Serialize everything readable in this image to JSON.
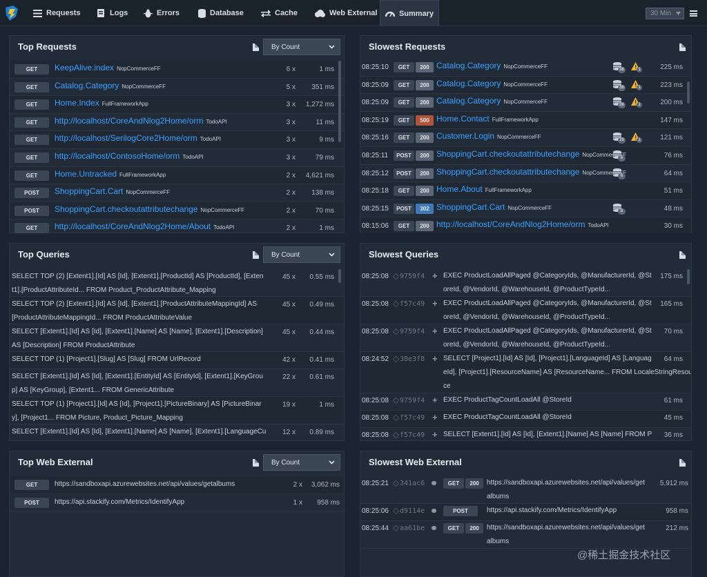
{
  "nav": {
    "tabs": [
      {
        "label": "Requests"
      },
      {
        "label": "Logs"
      },
      {
        "label": "Errors"
      },
      {
        "label": "Database"
      },
      {
        "label": "Cache"
      },
      {
        "label": "Web External"
      },
      {
        "label": "Summary"
      }
    ],
    "active_tab": "Summary",
    "time_range": "30 Min"
  },
  "top_requests": {
    "title": "Top Requests",
    "sort": "By Count",
    "rows": [
      {
        "verb": "GET",
        "name": "KeepAlive.index",
        "app": "NopCommerceFF",
        "count": "6 x",
        "ms": "1 ms"
      },
      {
        "verb": "GET",
        "name": "Catalog.Category",
        "app": "NopCommerceFF",
        "count": "5 x",
        "ms": "351 ms"
      },
      {
        "verb": "GET",
        "name": "Home.Index",
        "app": "FullFrameworkApp",
        "count": "3 x",
        "ms": "1,272 ms"
      },
      {
        "verb": "GET",
        "name": "http://localhost/CoreAndNlog2Home/orm",
        "app": "TodoAPI",
        "count": "3 x",
        "ms": "11 ms"
      },
      {
        "verb": "GET",
        "name": "http://localhost/SerilogCore2Home/orm",
        "app": "TodoAPI",
        "count": "3 x",
        "ms": "9 ms"
      },
      {
        "verb": "GET",
        "name": "http://localhost/ContosoHome/orm",
        "app": "TodoAPI",
        "count": "3 x",
        "ms": "79 ms"
      },
      {
        "verb": "GET",
        "name": "Home.Untracked",
        "app": "FullFrameworkApp",
        "count": "2 x",
        "ms": "4,621 ms"
      },
      {
        "verb": "POST",
        "name": "ShoppingCart.Cart",
        "app": "NopCommerceFF",
        "count": "2 x",
        "ms": "138 ms"
      },
      {
        "verb": "POST",
        "name": "ShoppingCart.checkoutattributechange",
        "app": "NopCommerceFF",
        "count": "2 x",
        "ms": "70 ms"
      },
      {
        "verb": "GET",
        "name": "http://localhost/CoreAndNlog2Home/About",
        "app": "TodoAPI",
        "count": "2 x",
        "ms": "1 ms"
      }
    ]
  },
  "slowest_requests": {
    "title": "Slowest Requests",
    "rows": [
      {
        "time": "08:25:10",
        "verb": "GET",
        "status": "200",
        "name": "Catalog.Category",
        "app": "NopCommerceFF",
        "db": "38",
        "warn": "1",
        "ms": "225 ms"
      },
      {
        "time": "08:25:09",
        "verb": "GET",
        "status": "200",
        "name": "Catalog.Category",
        "app": "NopCommerceFF",
        "db": "38",
        "warn": "1",
        "ms": "223 ms"
      },
      {
        "time": "08:25:09",
        "verb": "GET",
        "status": "200",
        "name": "Catalog.Category",
        "app": "NopCommerceFF",
        "db": "38",
        "warn": "1",
        "ms": "200 ms"
      },
      {
        "time": "08:25:19",
        "verb": "GET",
        "status": "500",
        "name": "Home.Contact",
        "app": "FullFrameworkApp",
        "db": "",
        "warn": "",
        "ms": "147 ms"
      },
      {
        "time": "08:25:16",
        "verb": "GET",
        "status": "200",
        "name": "Customer.Login",
        "app": "NopCommerceFF",
        "db": "29",
        "warn": "1",
        "ms": "121 ms"
      },
      {
        "time": "08:25:11",
        "verb": "POST",
        "status": "200",
        "name": "ShoppingCart.checkoutattributechange",
        "app": "NopCommerceFF",
        "db": "6",
        "warn": "",
        "ms": "76 ms"
      },
      {
        "time": "08:25:12",
        "verb": "POST",
        "status": "200",
        "name": "ShoppingCart.checkoutattributechange",
        "app": "NopCommerceFF",
        "db": "6",
        "warn": "",
        "ms": "64 ms"
      },
      {
        "time": "08:25:18",
        "verb": "GET",
        "status": "200",
        "name": "Home.About",
        "app": "FullFrameworkApp",
        "db": "",
        "warn": "",
        "ms": "51 ms"
      },
      {
        "time": "08:25:15",
        "verb": "POST",
        "status": "302",
        "name": "ShoppingCart.Cart",
        "app": "NopCommerceFF",
        "db": "8",
        "warn": "",
        "ms": "48 ms"
      },
      {
        "time": "08:15:06",
        "verb": "GET",
        "status": "200",
        "name": "http://localhost/CoreAndNlog2Home/orm",
        "app": "TodoAPI",
        "db": "",
        "warn": "",
        "ms": "30 ms"
      }
    ]
  },
  "top_queries": {
    "title": "Top Queries",
    "sort": "By Count",
    "rows": [
      {
        "l1": "SELECT TOP (2) [Extent1].[Id] AS [Id], [Extent1].[ProductId] AS [ProductId], [Exten",
        "l2": "t1].[ProductAttributeId... FROM Product_ProductAttribute_Mapping",
        "count": "45 x",
        "ms": "0.55 ms"
      },
      {
        "l1": "SELECT TOP (2) [Extent1].[Id] AS [Id], [Extent1].[ProductAttributeMappingId] AS",
        "l2": "[ProductAttributeMappingId... FROM ProductAttributeValue",
        "count": "45 x",
        "ms": "0.49 ms"
      },
      {
        "l1": "SELECT [Extent1].[Id] AS [Id], [Extent1].[Name] AS [Name], [Extent1].[Description]",
        "l2": "AS [Description] FROM ProductAttribute",
        "count": "45 x",
        "ms": "0.44 ms"
      },
      {
        "l1": "SELECT TOP (1) [Project1].[Slug] AS [Slug] FROM UrlRecord",
        "l2": "",
        "count": "42 x",
        "ms": "0.41 ms"
      },
      {
        "l1": "SELECT [Extent1].[Id] AS [Id], [Extent1].[EntityId] AS [EntityId], [Extent1].[KeyGrou",
        "l2": "p] AS [KeyGroup], [Extent1... FROM GenericAttribute",
        "count": "22 x",
        "ms": "0.61 ms"
      },
      {
        "l1": "SELECT TOP (1) [Project1].[Id] AS [Id], [Project1].[PictureBinary] AS [PictureBinar",
        "l2": "y], [Project1... FROM Picture, Product_Picture_Mapping",
        "count": "19 x",
        "ms": "1 ms"
      },
      {
        "l1": "SELECT [Extent1].[Id] AS [Id], [Extent1].[Name] AS [Name], [Extent1].[LanguageCu",
        "l2": "",
        "count": "12 x",
        "ms": "0.89 ms"
      }
    ]
  },
  "slowest_queries": {
    "title": "Slowest Queries",
    "rows": [
      {
        "time": "08:25:08",
        "hash": "9759f4",
        "l1": "EXEC ProductLoadAllPaged @CategoryIds, @ManufacturerId, @St",
        "l2": "oreId, @VendorId, @WarehouseId, @ProductTypeId...",
        "l3": "",
        "ms": "175 ms"
      },
      {
        "time": "08:25:08",
        "hash": "f57c49",
        "l1": "EXEC ProductLoadAllPaged @CategoryIds, @ManufacturerId, @St",
        "l2": "oreId, @VendorId, @WarehouseId, @ProductTypeId...",
        "l3": "",
        "ms": "165 ms"
      },
      {
        "time": "08:25:08",
        "hash": "9759f4",
        "l1": "EXEC ProductLoadAllPaged @CategoryIds, @ManufacturerId, @St",
        "l2": "oreId, @VendorId, @WarehouseId, @ProductTypeId...",
        "l3": "",
        "ms": "70 ms"
      },
      {
        "time": "08:24:52",
        "hash": "38e3f8",
        "l1": "SELECT [Project1].[Id] AS [Id], [Project1].[LanguageId] AS [Languag",
        "l2": "eId], [Project1].[ResourceName] AS [ResourceName... FROM LocaleStringResour",
        "l3": "ce",
        "ms": "64 ms"
      },
      {
        "time": "08:25:08",
        "hash": "9759f4",
        "l1": "EXEC ProductTagCountLoadAll @StoreId",
        "l2": "",
        "l3": "",
        "ms": "61 ms"
      },
      {
        "time": "08:25:08",
        "hash": "f57c49",
        "l1": "EXEC ProductTagCountLoadAll @StoreId",
        "l2": "",
        "l3": "",
        "ms": "45 ms"
      },
      {
        "time": "08:25:08",
        "hash": "f57c49",
        "l1": "SELECT [Extent1].[Id] AS [Id], [Extent1].[Name] AS [Name] FROM P",
        "l2": "",
        "l3": "",
        "ms": "36 ms"
      }
    ]
  },
  "top_web_external": {
    "title": "Top Web External",
    "sort": "By Count",
    "rows": [
      {
        "verb": "GET",
        "url": "https://sandboxapi.azurewebsites.net/api/values/getalbums",
        "count": "2 x",
        "ms": "3,062 ms"
      },
      {
        "verb": "POST",
        "url": "https://api.stackify.com/Metrics/IdentifyApp",
        "count": "1 x",
        "ms": "958 ms"
      }
    ]
  },
  "slowest_web_external": {
    "title": "Slowest Web External",
    "rows": [
      {
        "time": "08:25:21",
        "hash": "341ac6",
        "verb": "GET",
        "status": "200",
        "l1": "https://sandboxapi.azurewebsites.net/api/values/get",
        "l2": "albums",
        "ms": "5,912 ms"
      },
      {
        "time": "08:25:06",
        "hash": "d9114e",
        "verb": "POST",
        "status": "",
        "l1": "https://api.stackify.com/Metrics/IdentifyApp",
        "l2": "",
        "ms": "958 ms"
      },
      {
        "time": "08:25:44",
        "hash": "aa61be",
        "verb": "GET",
        "status": "200",
        "l1": "https://sandboxapi.azurewebsites.net/api/values/get",
        "l2": "albums",
        "ms": "212 ms"
      }
    ]
  },
  "watermark": "@稀土掘金技术社区",
  "colors": {
    "background": "#1b2430",
    "panel": "#222c38",
    "link": "#3ca0ff",
    "status_error": "#b0553a",
    "status_redirect": "#3f79b8",
    "warning": "#f0b429"
  }
}
